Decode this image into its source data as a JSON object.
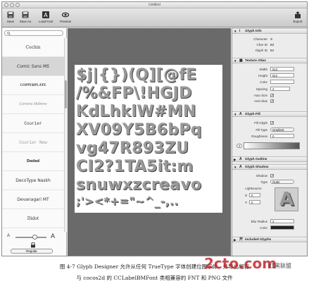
{
  "window": {
    "title": "Untitled"
  },
  "toolbar": {
    "save": "Save",
    "save_as": "Save As",
    "load_font": "Load Font",
    "preview": "Preview",
    "export": "Export"
  },
  "sidebar": {
    "fonts": [
      "Cochin",
      "Comic Sans MS",
      "COPPERPLATE",
      "Corsiva Hebrew",
      "Courier",
      "Courier New",
      "Dadad",
      "DecoType Naskh",
      "Devanagari MT",
      "Didot"
    ],
    "selected_index": 1,
    "style_select": "Regular"
  },
  "atlas": {
    "rows": [
      "$j|{})(Q][@fE",
      "/%&FP\\!HGJD",
      "KdLhklW#MN",
      "XV09Y5B6bPq",
      "vg47R893ZU",
      "CI2?1TA5it:m",
      "snuwxzcreavo",
      ";'><*+=\"~^_-,.."
    ]
  },
  "inspector": {
    "glyph_info": {
      "title": "Glyph Info",
      "character_label": "Character",
      "character_value": "S",
      "charid_label": "Char ID",
      "charid_value": "83",
      "glyphid_label": "Glyph ID",
      "glyphid_value": "54"
    },
    "texture_atlas": {
      "title": "Texture Atlas",
      "width_label": "Width",
      "width_value": "512",
      "height_label": "Height",
      "height_value": "512",
      "color_label": "Color",
      "spacing_label": "Spacing",
      "spacing_value": "2",
      "autosize_label": "Auto Size",
      "antialias_label": "Anti-Alias"
    },
    "glyph_fill": {
      "title": "Glyph Fill",
      "fill_glyph_label": "Fill Glyph",
      "fill_type_label": "Fill Type",
      "fill_type_value": "Gradient",
      "roughness_label": "Roughness",
      "roughness_value": "0"
    },
    "glyph_outline": {
      "title": "Glyph Outline"
    },
    "glyph_shadow": {
      "title": "Glyph Shadow",
      "shadow_label": "Shadow",
      "type_label": "Type",
      "type_value": "Outer",
      "lightsource_label": "Lightsource",
      "x_label": "X",
      "x_value": "0",
      "y_label": "Y",
      "y_value": "0",
      "preview_letter": "A",
      "blur_radius_label": "Blur Radius",
      "blur_radius_value": "2",
      "color_label": "Color"
    },
    "included_glyphs": {
      "title": "Included Glyphs"
    }
  },
  "caption": {
    "line1": "图 4-7   Glyph Designer 允许从任何 TrueType 字体创建位图字体，并导出相容",
    "line2": "与 cocos2d 的 CCLabelBMFont 类相兼容的 FNT 和 PNG 文件"
  },
  "watermark": {
    "text": "2cto.com",
    "sub": "红黑联盟"
  }
}
